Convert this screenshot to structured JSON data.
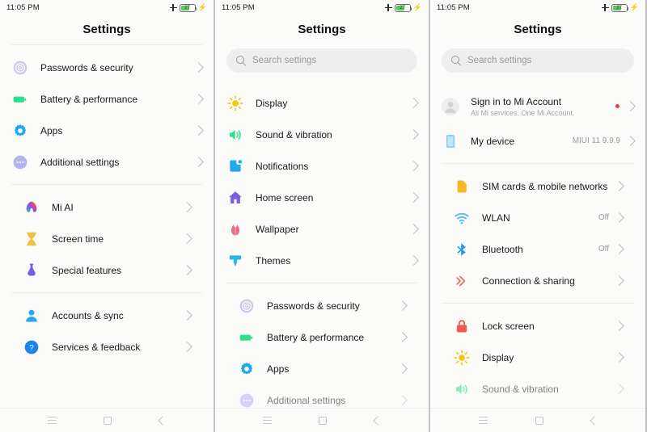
{
  "status_bar": {
    "time": "11:05 PM",
    "battery_percent": "27",
    "airplane_icon": "plus-icon",
    "battery_icon": "battery-icon",
    "charging_icon": "bolt-icon"
  },
  "nav_bar": {
    "menu_icon": "hamburger-menu-icon",
    "home_icon": "home-square-icon",
    "back_icon": "back-chevron-icon"
  },
  "panel1": {
    "title": "Settings",
    "groups": [
      {
        "items": [
          {
            "label": "Passwords & security",
            "icon": "fingerprint-icon",
            "color": "#a9a3e0",
            "value": ""
          },
          {
            "label": "Battery & performance",
            "icon": "battery-icon",
            "color": "#2ddf8a",
            "value": ""
          },
          {
            "label": "Apps",
            "icon": "gear-icon",
            "color": "#22a7f0",
            "value": ""
          },
          {
            "label": "Additional settings",
            "icon": "more-settings-icon",
            "color": "#9b9be8",
            "value": ""
          }
        ]
      },
      {
        "items": [
          {
            "label": "Mi AI",
            "icon": "mi-ai-icon",
            "color": "#e0558a",
            "value": ""
          },
          {
            "label": "Screen time",
            "icon": "hourglass-icon",
            "color": "#f0c040",
            "value": ""
          },
          {
            "label": "Special features",
            "icon": "flask-icon",
            "color": "#7a5ce8",
            "value": ""
          }
        ]
      },
      {
        "items": [
          {
            "label": "Accounts & sync",
            "icon": "person-icon",
            "color": "#22a7f0",
            "value": ""
          },
          {
            "label": "Services & feedback",
            "icon": "question-circle-icon",
            "color": "#1a84f0",
            "value": ""
          }
        ]
      }
    ]
  },
  "panel2": {
    "title": "Settings",
    "search_placeholder": "Search settings",
    "search_value": "",
    "groups": [
      {
        "items": [
          {
            "label": "Display",
            "icon": "sun-icon",
            "color": "#f5c518",
            "value": ""
          },
          {
            "label": "Sound & vibration",
            "icon": "speaker-icon",
            "color": "#2ddf8a",
            "value": ""
          },
          {
            "label": "Notifications",
            "icon": "notification-square-icon",
            "color": "#22a7f0",
            "value": ""
          },
          {
            "label": "Home screen",
            "icon": "house-icon",
            "color": "#7a5ce8",
            "value": ""
          },
          {
            "label": "Wallpaper",
            "icon": "flower-icon",
            "color": "#ef6a87",
            "value": ""
          },
          {
            "label": "Themes",
            "icon": "brush-icon",
            "color": "#29b6e8",
            "value": ""
          }
        ]
      },
      {
        "items": [
          {
            "label": "Passwords & security",
            "icon": "fingerprint-icon",
            "color": "#a9a3e0",
            "value": ""
          },
          {
            "label": "Battery & performance",
            "icon": "battery-icon",
            "color": "#2ddf8a",
            "value": ""
          },
          {
            "label": "Apps",
            "icon": "gear-icon",
            "color": "#22a7f0",
            "value": ""
          },
          {
            "label": "Additional settings",
            "icon": "more-settings-icon",
            "color": "#9b9be8",
            "value": "",
            "cut_off": true
          }
        ]
      }
    ]
  },
  "panel3": {
    "title": "Settings",
    "search_placeholder": "Search settings",
    "search_value": "",
    "account": {
      "label": "Sign in to Mi Account",
      "sublabel": "All Mi services. One Mi Account.",
      "icon": "avatar-icon",
      "badge_color": "#e8413a"
    },
    "groups": [
      {
        "items": [
          {
            "label": "My device",
            "icon": "device-icon",
            "color": "#7fc8f0",
            "value": "MIUI 11 9.9.9"
          }
        ]
      },
      {
        "items": [
          {
            "label": "SIM cards & mobile networks",
            "icon": "sim-card-icon",
            "color": "#f5b820",
            "value": ""
          },
          {
            "label": "WLAN",
            "icon": "wifi-icon",
            "color": "#4bb8e8",
            "value": "Off"
          },
          {
            "label": "Bluetooth",
            "icon": "bluetooth-icon",
            "color": "#2196f3",
            "value": "Off"
          },
          {
            "label": "Connection & sharing",
            "icon": "connection-sharing-icon",
            "color": "#e8705c",
            "value": ""
          }
        ]
      },
      {
        "items": [
          {
            "label": "Lock screen",
            "icon": "lock-icon",
            "color": "#ef5b4c",
            "value": ""
          },
          {
            "label": "Display",
            "icon": "sun-icon",
            "color": "#f5c518",
            "value": ""
          },
          {
            "label": "Sound & vibration",
            "icon": "speaker-icon",
            "color": "#2ddf8a",
            "value": "",
            "cut_off": true
          }
        ]
      }
    ]
  }
}
